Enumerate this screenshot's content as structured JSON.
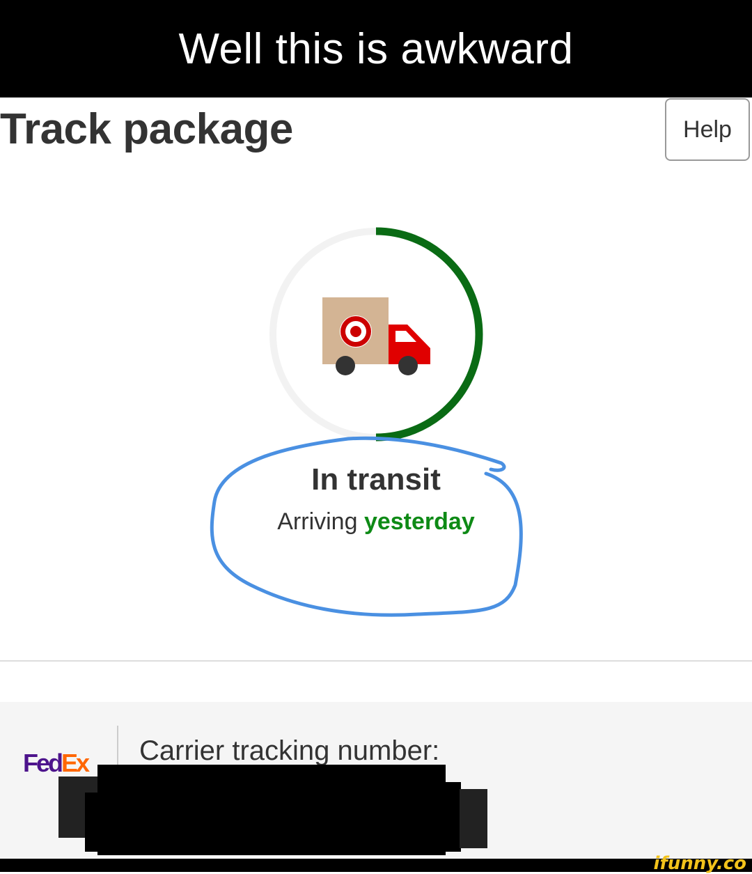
{
  "meme": {
    "caption": "Well this is awkward"
  },
  "header": {
    "title": "Track package",
    "help_label": "Help"
  },
  "status": {
    "title": "In transit",
    "arrival_prefix": "Arriving",
    "arrival_value": "yesterday",
    "progress_fraction": 0.5
  },
  "icons": {
    "truck": "delivery-truck-icon",
    "brand": "target-bullseye-icon"
  },
  "carrier": {
    "logo_fed": "Fed",
    "logo_ex": "Ex",
    "tracking_label": "Carrier tracking number:"
  },
  "watermark": "ifunny.co",
  "colors": {
    "progress": "#0a6b14",
    "track": "#f2f2f2",
    "arrival": "#0e8a16",
    "annotation": "#4a90e2",
    "fedex_purple": "#4d148c",
    "fedex_orange": "#ff6600"
  }
}
